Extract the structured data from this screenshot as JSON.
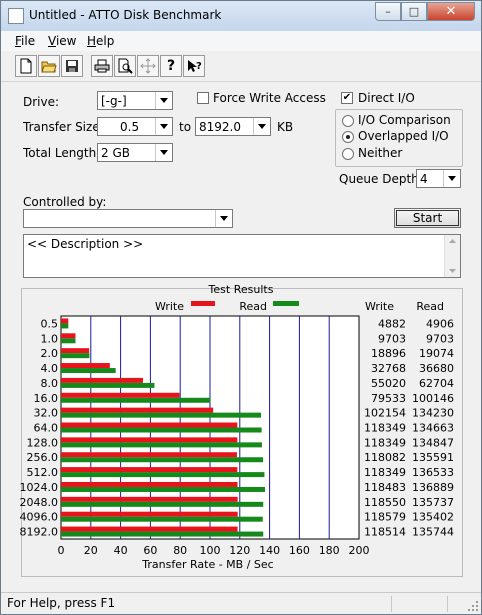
{
  "window": {
    "title": "Untitled - ATTO Disk Benchmark",
    "close_glyph": "✕",
    "min_glyph": "–",
    "max_glyph": "□"
  },
  "menu": [
    {
      "key": "F",
      "rest": "ile"
    },
    {
      "key": "V",
      "rest": "iew"
    },
    {
      "key": "H",
      "rest": "elp"
    }
  ],
  "toolbar": {
    "icons": [
      "new-file-icon",
      "open-folder-icon",
      "save-icon",
      "print-icon",
      "print-preview-icon",
      "move-icon",
      "help-icon",
      "context-help-icon"
    ],
    "help_glyph": "?"
  },
  "form": {
    "drive_label": "Drive:",
    "drive_value": "[-g-]",
    "force_write_label": "Force Write Access",
    "force_write_checked": false,
    "direct_io_label": "Direct I/O",
    "direct_io_checked": true,
    "direct_io_mark": "✔",
    "transfer_size_label": "Transfer Size:",
    "transfer_from": "0.5",
    "to_label": "to",
    "transfer_to": "8192.0",
    "kb_label": "KB",
    "total_length_label": "Total Length:",
    "total_length_value": "2 GB",
    "io_options": [
      "I/O Comparison",
      "Overlapped I/O",
      "Neither"
    ],
    "io_selected": 1,
    "queue_depth_label": "Queue Depth:",
    "queue_depth_value": "4",
    "controlled_by_label": "Controlled by:",
    "controlled_by_value": "",
    "start_label": "Start",
    "description": "<< Description >>"
  },
  "chart_data": {
    "type": "bar",
    "title": "Test Results",
    "orientation": "horizontal",
    "categories": [
      "0.5",
      "1.0",
      "2.0",
      "4.0",
      "8.0",
      "16.0",
      "32.0",
      "64.0",
      "128.0",
      "256.0",
      "512.0",
      "1024.0",
      "2048.0",
      "4096.0",
      "8192.0"
    ],
    "series": [
      {
        "name": "Write",
        "color": "#e8141b",
        "values": [
          4882,
          9703,
          18896,
          32768,
          55020,
          79533,
          102154,
          118349,
          118349,
          118082,
          118349,
          118483,
          118550,
          118579,
          118514
        ]
      },
      {
        "name": "Read",
        "color": "#158a1b",
        "values": [
          4906,
          9703,
          19074,
          36680,
          62704,
          100146,
          134230,
          134663,
          134847,
          135591,
          136533,
          136889,
          135737,
          135402,
          135744
        ]
      }
    ],
    "table_headers": [
      "Write",
      "Read"
    ],
    "xlabel": "Transfer Rate - MB / Sec",
    "xlim": [
      0,
      200
    ],
    "xticks": [
      0,
      20,
      40,
      60,
      80,
      100,
      120,
      140,
      160,
      180,
      200
    ],
    "value_unit_divisor": 1000,
    "grid_color": "#1a1aa0"
  },
  "status": {
    "text": "For Help, press F1"
  }
}
